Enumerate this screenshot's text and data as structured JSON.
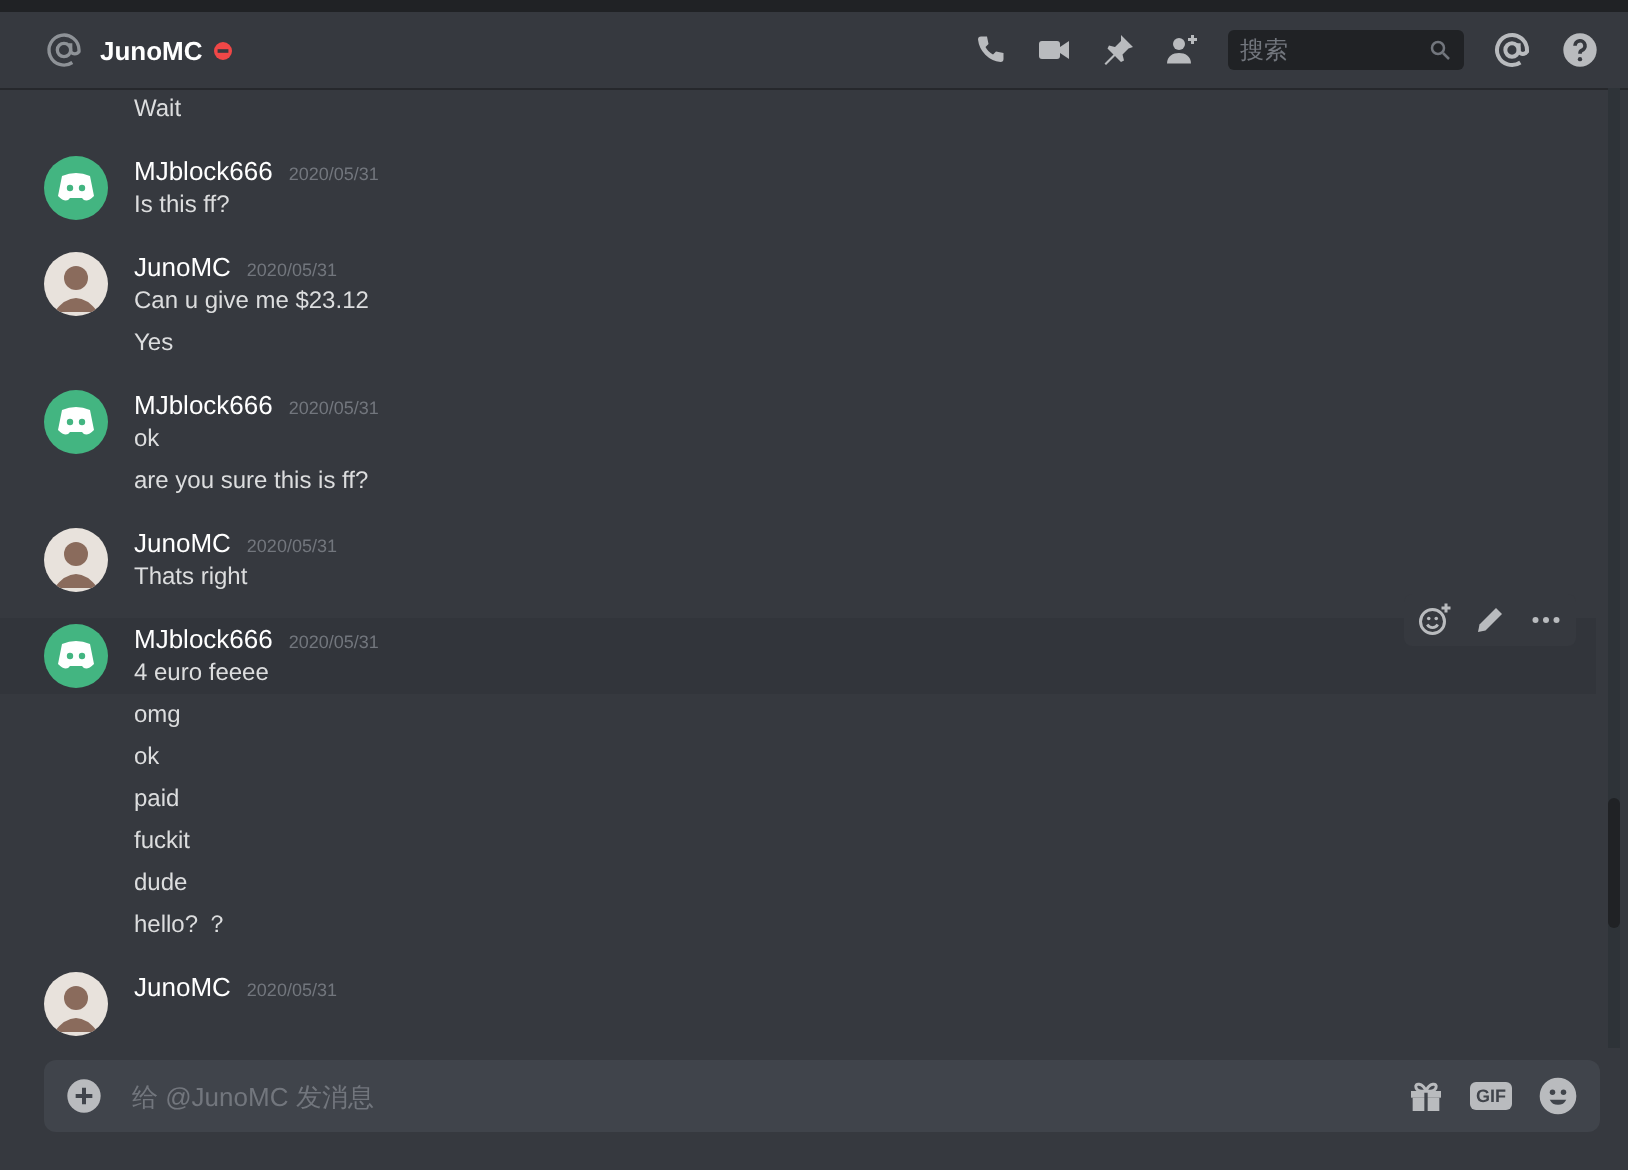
{
  "header": {
    "channel": "JunoMC",
    "do_not_disturb": true,
    "search": {
      "placeholder": "搜索"
    }
  },
  "messages": [
    {
      "kind": "continued",
      "hovered": false,
      "lines": [
        "Wait"
      ]
    },
    {
      "kind": "bot",
      "author": "MJblock666",
      "time": "2020/05/31",
      "hovered": false,
      "lines": [
        "Is this ff?"
      ]
    },
    {
      "kind": "user",
      "author": "JunoMC",
      "time": "2020/05/31",
      "hovered": false,
      "lines": [
        "Can u give me $23.12",
        "Yes"
      ]
    },
    {
      "kind": "bot",
      "author": "MJblock666",
      "time": "2020/05/31",
      "hovered": false,
      "lines": [
        "ok",
        "are you sure this is ff?"
      ]
    },
    {
      "kind": "user",
      "author": "JunoMC",
      "time": "2020/05/31",
      "hovered": false,
      "lines": [
        "Thats right"
      ]
    },
    {
      "kind": "bot",
      "author": "MJblock666",
      "time": "2020/05/31",
      "hovered": true,
      "lines": [
        "4 euro feeee",
        "omg",
        "ok",
        "paid",
        "fuckit",
        "dude",
        "hello? ？"
      ]
    },
    {
      "kind": "user",
      "author": "JunoMC",
      "time": "2020/05/31",
      "hovered": false
    }
  ],
  "composer": {
    "placeholder": "给 @JunoMC 发消息",
    "gif": "GIF"
  }
}
